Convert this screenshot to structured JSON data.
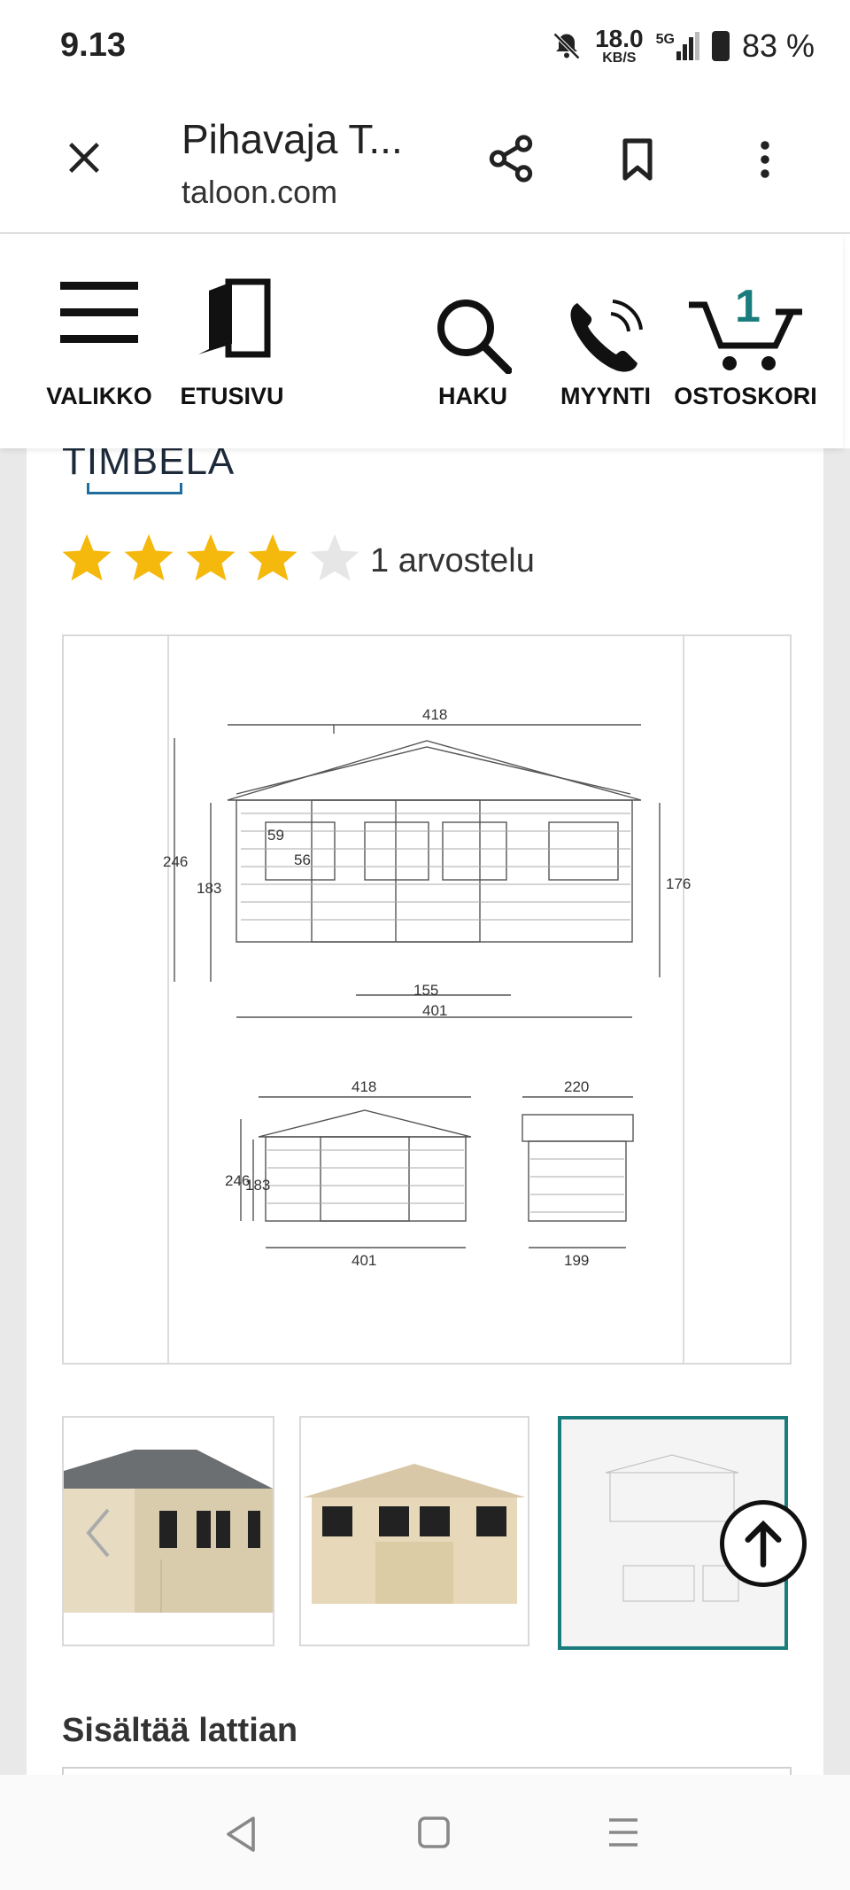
{
  "status_bar": {
    "time": "9.13",
    "network_speed": "18.0",
    "network_speed_unit": "KB/S",
    "network_type": "5G",
    "battery": "83 %"
  },
  "browser": {
    "title": "Pihavaja T...",
    "url": "taloon.com"
  },
  "header": {
    "nav": [
      {
        "label": "VALIKKO",
        "icon": "menu-icon"
      },
      {
        "label": "ETUSIVU",
        "icon": "door-icon"
      },
      {
        "label": "HAKU",
        "icon": "search-icon"
      },
      {
        "label": "MYYNTI",
        "icon": "phone-icon"
      },
      {
        "label": "OSTOSKORI",
        "icon": "cart-icon"
      }
    ],
    "cart_count": "1"
  },
  "product": {
    "brand": "TIMBELA",
    "rating": 4,
    "rating_max": 5,
    "review_text": "1 arvostelu",
    "drawing": {
      "front": {
        "width": "418",
        "base": "401",
        "door": "155",
        "height_total": "246",
        "height_wall": "183",
        "height_right": "176",
        "window_h": "59",
        "window_w": "56"
      },
      "small_front": {
        "width": "418",
        "base": "401",
        "height_total": "246",
        "height_wall": "183"
      },
      "side": {
        "width": "220",
        "base": "199"
      }
    },
    "thumbnails": [
      {
        "name": "shed-side-view"
      },
      {
        "name": "shed-front-view"
      },
      {
        "name": "shed-drawing",
        "selected": true
      }
    ],
    "feature_title": "Sisältää lattian"
  },
  "colors": {
    "accent": "#1a7c7c",
    "star": "#f5b80c",
    "star_empty": "#e6e6e6",
    "brand_line": "#1f6f9e"
  }
}
